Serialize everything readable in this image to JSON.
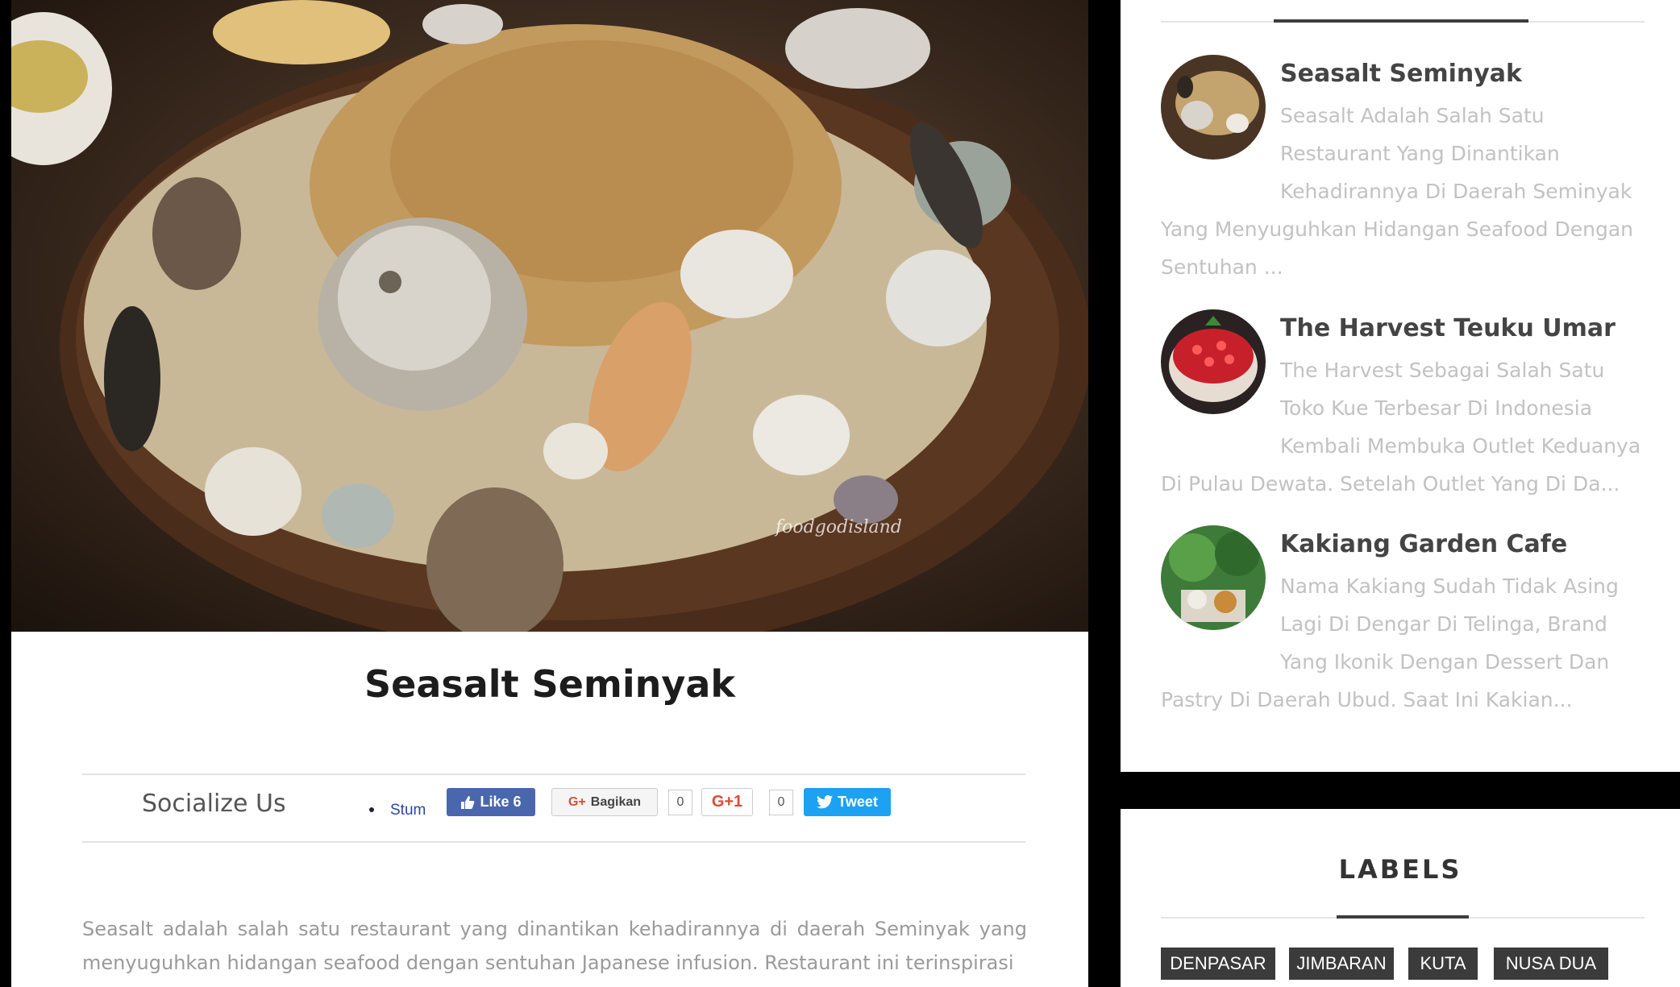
{
  "article": {
    "title": "Seasalt Seminyak",
    "watermark": "foodgodisland",
    "excerpt": "Seasalt adalah salah satu restaurant yang dinantikan kehadirannya di daerah Seminyak yang menyuguhkan hidangan seafood dengan sentuhan Japanese infusion. Restaurant ini terinspirasi"
  },
  "share": {
    "label": "Socialize Us",
    "stumble": "Stum",
    "like": "Like 6",
    "bagikan": "Bagikan",
    "bagikan_count": "0",
    "gplus": "G+1",
    "gplus_count": "0",
    "tweet": "Tweet"
  },
  "sidebar": {
    "popular_posts": [
      {
        "title": "Seasalt Seminyak",
        "description": "Seasalt Adalah Salah Satu Restaurant Yang Dinantikan Kehadirannya Di Daerah Seminyak Yang Menyuguhkan Hidangan Seafood Dengan Sentuhan ..."
      },
      {
        "title": "The Harvest Teuku Umar",
        "description": "The Harvest Sebagai Salah Satu Toko Kue Terbesar Di Indonesia Kembali Membuka Outlet Keduanya Di Pulau Dewata. Setelah Outlet Yang Di Da..."
      },
      {
        "title": "Kakiang Garden Cafe",
        "description": "Nama Kakiang Sudah Tidak Asing Lagi Di Dengar Di Telinga, Brand Yang Ikonik Dengan Dessert Dan Pastry Di Daerah Ubud. Saat Ini Kakian..."
      }
    ],
    "labels": {
      "title": "LABELS",
      "tags": [
        "DENPASAR",
        "JIMBARAN",
        "KUTA",
        "NUSA DUA"
      ]
    }
  },
  "colors": {
    "page_background": "#000000",
    "card_background": "#ffffff",
    "tag_background": "#3b3b3b",
    "facebook": "#4a67ad",
    "twitter": "#1da1f2",
    "gplus": "#dd4b39"
  },
  "icons": [
    "thumbs-up-icon",
    "google-icon",
    "twitter-bird-icon"
  ]
}
